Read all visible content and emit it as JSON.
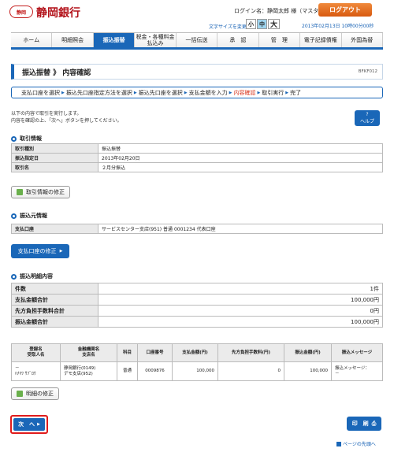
{
  "header": {
    "logo_text": "静岡",
    "bank_name": "静岡銀行",
    "login_text": "ログイン名：静岡太郎 様（マスターユーザ）",
    "logout": "ログアウト",
    "fontsize_label": "文字サイズを変更",
    "fs_small": "小",
    "fs_mid": "中",
    "fs_large": "大",
    "datetime": "2013年02月13日 10時00分00秒"
  },
  "nav": {
    "items": [
      "ホーム",
      "明細照会",
      "振込振替",
      "税金・各種料金払込み",
      "一括伝送",
      "承　認",
      "管　理",
      "電子記録債権",
      "外国為替"
    ],
    "active": 2
  },
  "page": {
    "title": "振込振替 》 内容確認",
    "screen_code": "BFKF012"
  },
  "steps": {
    "items": [
      "支払口座を選択",
      "振込先口座指定方法を選択",
      "振込先口座を選択",
      "支払金額を入力",
      "内容確認",
      "取引実行",
      "完了"
    ],
    "current": 4
  },
  "intro": {
    "line1": "以下の内容で取引を実行します。",
    "line2": "内容を確認の上、「次へ」ボタンを押してください。",
    "help": "ヘルプ"
  },
  "trade": {
    "title": "取引情報",
    "rows": [
      {
        "k": "取引種別",
        "v": "振込振替"
      },
      {
        "k": "振込指定日",
        "v": "2013年02月20日"
      },
      {
        "k": "取引名",
        "v": "２月分振込"
      }
    ],
    "edit": "取引情報の修正"
  },
  "source": {
    "title": "振込元情報",
    "k": "支払口座",
    "v": "サービスセンター支店(951) 普通 0001234 代表口座",
    "edit": "支払口座の修正"
  },
  "detail": {
    "title": "振込明細内容",
    "rows": [
      {
        "k": "件数",
        "v": "1件"
      },
      {
        "k": "支払金額合計",
        "v": "100,000円"
      },
      {
        "k": "先方負担手数料合計",
        "v": "0円"
      },
      {
        "k": "振込金額合計",
        "v": "100,000円"
      }
    ]
  },
  "list": {
    "headers": [
      "登録名\n受取人名",
      "金融機関名\n支店名",
      "科目",
      "口座番号",
      "支払金額(円)",
      "先方負担手数料(円)",
      "振込金額(円)",
      "振込メッセージ"
    ],
    "row": {
      "reg": "－",
      "recv": "ﾊﾅﾏﾂ ｻﾌﾞﾛｳ",
      "bank": "静岡銀行(0149)",
      "branch": "デモ支店(952)",
      "type": "普通",
      "acct": "0009876",
      "pay": "100,000",
      "fee": "0",
      "amount": "100,000",
      "msg1": "振込メッセージ：",
      "msg2": "－"
    }
  },
  "buttons": {
    "edit_detail": "明細の修正",
    "next": "次　へ",
    "print": "印　刷",
    "to_top": "ページの先頭へ"
  }
}
